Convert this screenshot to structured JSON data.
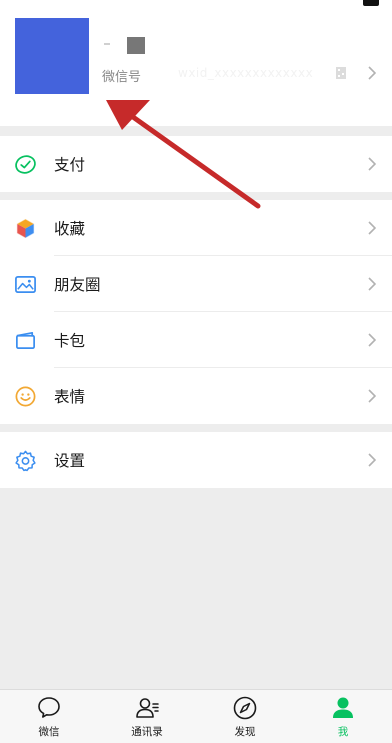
{
  "profile": {
    "wechat_id_label": "微信号",
    "wechat_id_value": "wxid_xxxxxxxxxxxxx"
  },
  "menu": {
    "pay_label": "支付",
    "favorites_label": "收藏",
    "moments_label": "朋友圈",
    "cards_label": "卡包",
    "stickers_label": "表情",
    "settings_label": "设置"
  },
  "tabbar": {
    "chats_label": "微信",
    "contacts_label": "通讯录",
    "discover_label": "发现",
    "me_label": "我",
    "active_tab": "我"
  },
  "colors": {
    "avatar_placeholder": "#4463dc",
    "accent_green": "#07c160",
    "annotation_arrow": "#c62a2a",
    "background": "#ededed"
  },
  "icons": [
    "camera-icon",
    "qr-code-icon",
    "chevron-right-icon",
    "pay-check-icon",
    "favorites-cube-icon",
    "moments-picture-icon",
    "card-wallet-icon",
    "sticker-smile-icon",
    "settings-gear-icon",
    "chat-bubble-icon",
    "contacts-person-icon",
    "discover-compass-icon",
    "me-person-icon"
  ]
}
